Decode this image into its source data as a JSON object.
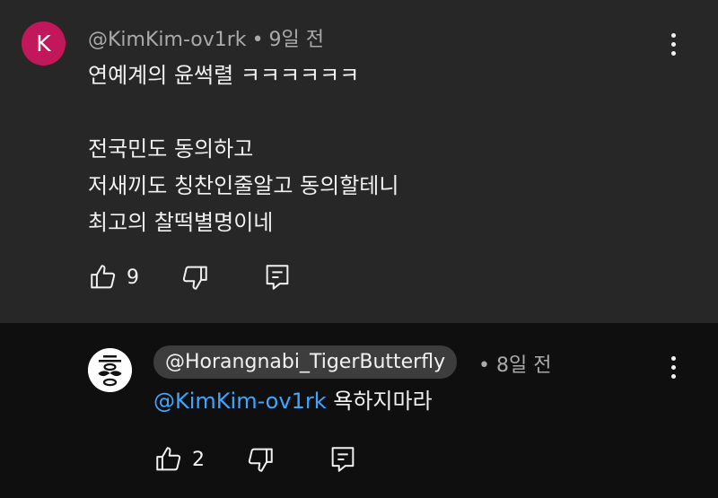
{
  "comment": {
    "avatar_letter": "K",
    "avatar_color": "#c2185b",
    "author": "@KimKim-ov1rk",
    "separator": "•",
    "time": "9일 전",
    "lines": [
      "연예계의 윤썩렬 ㅋㅋㅋㅋㅋㅋ",
      "",
      "전국민도 동의하고",
      "저새끼도 칭찬인줄알고 동의할테니",
      "최고의 찰떡별명이네"
    ],
    "likes": "9",
    "icons": {
      "like": "thumbs-up-icon",
      "dislike": "thumbs-down-icon",
      "reply": "reply-icon",
      "menu": "more-vert-icon"
    }
  },
  "reply": {
    "avatar_icon": "mustache-logo-icon",
    "author": "@Horangnabi_TigerButterfly",
    "separator": "•",
    "time": "8일 전",
    "mention": "@KimKim-ov1rk",
    "text": "욕하지마라",
    "likes": "2",
    "mention_color": "#3ea6ff"
  }
}
